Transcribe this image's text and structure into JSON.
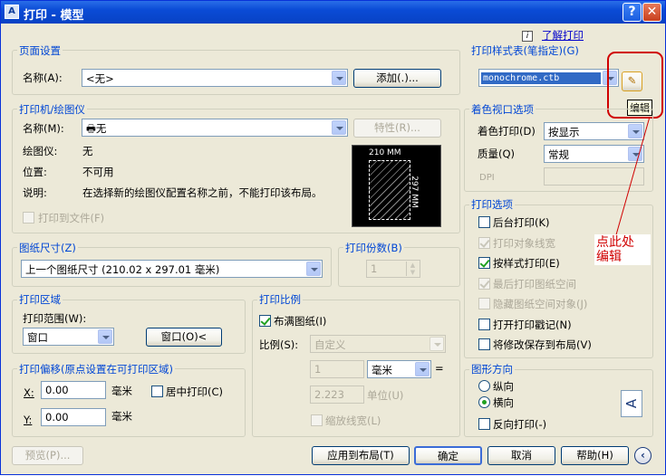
{
  "title": "打印 - 模型",
  "icon_text": "A",
  "help_link": "了解打印",
  "info_icon": "i",
  "page_setup": {
    "title": "页面设置",
    "name_label": "名称(A):",
    "name_value": "<无>",
    "add_button": "添加(.)..."
  },
  "printer": {
    "title": "打印机/绘图仪",
    "name_label": "名称(M):",
    "name_value": "无",
    "properties_button": "特性(R)...",
    "plotter_label": "绘图仪:",
    "plotter_value": "无",
    "location_label": "位置:",
    "location_value": "不可用",
    "desc_label": "说明:",
    "desc_value": "在选择新的绘图仪配置名称之前，不能打印该布局。",
    "print_to_file": "打印到文件(F)",
    "preview_width": "210 MM",
    "preview_height": "297 MM"
  },
  "paper_size": {
    "title": "图纸尺寸(Z)",
    "value": "上一个图纸尺寸 (210.02 x 297.01 毫米)"
  },
  "copies": {
    "title": "打印份数(B)",
    "value": "1"
  },
  "plot_area": {
    "title": "打印区域",
    "range_label": "打印范围(W):",
    "range_value": "窗口",
    "window_button": "窗口(O)<"
  },
  "plot_offset": {
    "title": "打印偏移(原点设置在可打印区域)",
    "x_label": "X:",
    "x_value": "0.00",
    "x_unit": "毫米",
    "y_label": "Y:",
    "y_value": "0.00",
    "y_unit": "毫米",
    "center_label": "居中打印(C)"
  },
  "plot_scale": {
    "title": "打印比例",
    "fit_label": "布满图纸(I)",
    "scale_label": "比例(S):",
    "scale_value": "自定义",
    "value1": "1",
    "unit1": "毫米",
    "eq": "=",
    "value2": "2.223",
    "unit2": "单位(U)",
    "lineweights": "缩放线宽(L)"
  },
  "style_table": {
    "title": "打印样式表(笔指定)(G)",
    "value": "monochrome.ctb",
    "edit_tooltip": "编辑"
  },
  "shaded_viewport": {
    "title": "着色视口选项",
    "shade_label": "着色打印(D)",
    "shade_value": "按显示",
    "quality_label": "质量(Q)",
    "quality_value": "常规",
    "dpi_label": "DPI"
  },
  "plot_options": {
    "title": "打印选项",
    "items": [
      {
        "label": "后台打印(K)",
        "checked": false,
        "disabled": false
      },
      {
        "label": "打印对象线宽",
        "checked": true,
        "disabled": true
      },
      {
        "label": "按样式打印(E)",
        "checked": true,
        "disabled": false
      },
      {
        "label": "最后打印图纸空间",
        "checked": true,
        "disabled": true
      },
      {
        "label": "隐藏图纸空间对象(J)",
        "checked": false,
        "disabled": true
      },
      {
        "label": "打开打印戳记(N)",
        "checked": false,
        "disabled": false
      },
      {
        "label": "将修改保存到布局(V)",
        "checked": false,
        "disabled": false
      }
    ]
  },
  "orientation": {
    "title": "图形方向",
    "portrait": "纵向",
    "landscape": "横向",
    "reverse": "反向打印(-)",
    "selected": "landscape",
    "preview_letter": "A"
  },
  "annotation": {
    "line1": "点此处",
    "line2": "编辑",
    "color": "#d00000"
  },
  "footer": {
    "preview": "预览(P)...",
    "apply": "应用到布局(T)",
    "ok": "确定",
    "cancel": "取消",
    "help": "帮助(H)"
  },
  "colors": {
    "accent": "#0046d5",
    "title_bar": "#0a4bd6",
    "highlight": "#316ac5"
  }
}
